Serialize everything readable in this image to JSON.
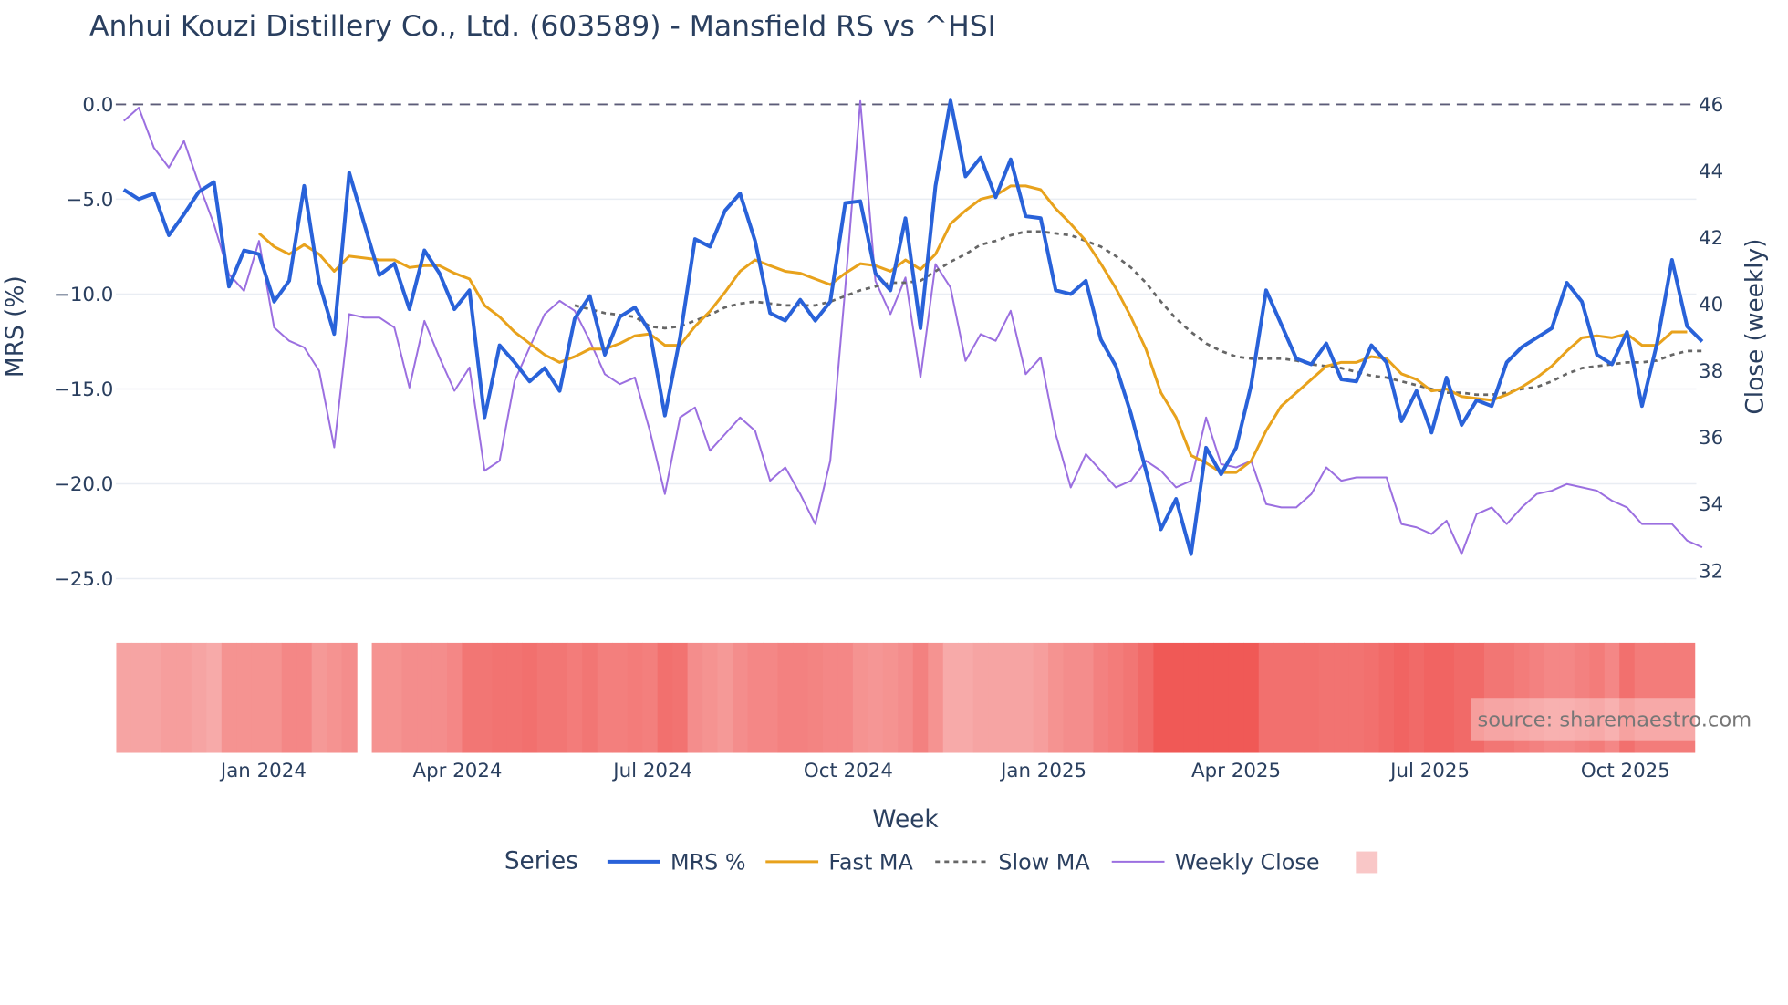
{
  "chart_data": {
    "type": "line",
    "title": "Anhui Kouzi Distillery Co., Ltd. (603589) - Mansfield RS vs ^HSI",
    "xlabel": "Week",
    "ylabel": "MRS (%)",
    "y2label": "Close (weekly)",
    "ylim": [
      -25,
      0
    ],
    "y2lim": [
      32,
      46
    ],
    "y_ticks": [
      "0.0",
      "−5.0",
      "−10.0",
      "−15.0",
      "−20.0",
      "−25.0"
    ],
    "y_tick_values": [
      0,
      -5,
      -10,
      -15,
      -20,
      -25
    ],
    "y2_ticks": [
      "46",
      "44",
      "42",
      "40",
      "38",
      "36",
      "34",
      "32"
    ],
    "y2_tick_values": [
      46,
      44,
      42,
      40,
      38,
      36,
      34,
      32
    ],
    "x_ticks": [
      "Jan 2024",
      "Apr 2024",
      "Jul 2024",
      "Oct 2024",
      "Jan 2025",
      "Apr 2025",
      "Jul 2025",
      "Oct 2025"
    ],
    "x_tick_week_index": [
      9.3,
      22.2,
      35.2,
      48.2,
      61.2,
      74,
      86.9,
      99.9
    ],
    "weeks": 105,
    "grid": true,
    "reference_line": 0,
    "legend_title": "Series",
    "legend_placement": "bottom-center",
    "series": [
      {
        "name": "MRS %",
        "axis": "left",
        "color": "#2962d9",
        "style": "solid",
        "start_index": 0,
        "values": [
          -4.5,
          -5.0,
          -4.7,
          -6.9,
          -5.8,
          -4.6,
          -4.1,
          -9.6,
          -7.7,
          -7.9,
          -10.4,
          -9.3,
          -4.3,
          -9.4,
          -12.1,
          -3.6,
          -6.3,
          -9.0,
          -8.4,
          -10.8,
          -7.7,
          -8.9,
          -10.8,
          -9.8,
          -16.5,
          -12.7,
          -13.6,
          -14.6,
          -13.9,
          -15.1,
          -11.3,
          -10.1,
          -13.2,
          -11.2,
          -10.7,
          -12.0,
          -16.4,
          -12.3,
          -7.1,
          -7.5,
          -5.6,
          -4.7,
          -7.2,
          -11.0,
          -11.4,
          -10.3,
          -11.4,
          -10.4,
          -5.2,
          -5.1,
          -8.9,
          -9.8,
          -6.0,
          -11.8,
          -4.3,
          0.2,
          -3.8,
          -2.8,
          -4.9,
          -2.9,
          -5.9,
          -6.0,
          -9.8,
          -10.0,
          -9.3,
          -12.4,
          -13.8,
          -16.3,
          -19.3,
          -22.4,
          -20.8,
          -23.7,
          -18.1,
          -19.5,
          -18.1,
          -14.8,
          -9.8,
          -11.6,
          -13.4,
          -13.7,
          -12.6,
          -14.5,
          -14.6,
          -12.7,
          -13.6,
          -16.7,
          -15.1,
          -17.3,
          -14.4,
          -16.9,
          -15.6,
          -15.9,
          -13.6,
          -12.8,
          -12.3,
          -11.8,
          -9.4,
          -10.4,
          -13.2,
          -13.7,
          -12.0,
          -15.9,
          -12.6,
          -8.2,
          -11.7,
          -12.5
        ]
      },
      {
        "name": "Fast MA",
        "axis": "left",
        "color": "#e8a21c",
        "style": "solid",
        "start_index": 9,
        "values": [
          -6.8,
          -7.5,
          -7.9,
          -7.4,
          -7.9,
          -8.8,
          -8.0,
          -8.1,
          -8.2,
          -8.2,
          -8.6,
          -8.5,
          -8.5,
          -8.9,
          -9.2,
          -10.6,
          -11.2,
          -12.0,
          -12.6,
          -13.2,
          -13.6,
          -13.3,
          -12.9,
          -12.9,
          -12.6,
          -12.2,
          -12.1,
          -12.7,
          -12.7,
          -11.7,
          -10.9,
          -9.9,
          -8.8,
          -8.2,
          -8.5,
          -8.8,
          -8.9,
          -9.2,
          -9.5,
          -8.9,
          -8.4,
          -8.5,
          -8.8,
          -8.2,
          -8.7,
          -7.9,
          -6.3,
          -5.6,
          -5.0,
          -4.8,
          -4.3,
          -4.3,
          -4.5,
          -5.5,
          -6.3,
          -7.2,
          -8.4,
          -9.7,
          -11.2,
          -12.9,
          -15.2,
          -16.5,
          -18.5,
          -18.9,
          -19.4,
          -19.4,
          -18.8,
          -17.2,
          -15.9,
          -15.2,
          -14.5,
          -13.8,
          -13.6,
          -13.6,
          -13.3,
          -13.4,
          -14.2,
          -14.5,
          -15.1,
          -15.0,
          -15.4,
          -15.5,
          -15.6,
          -15.3,
          -14.9,
          -14.4,
          -13.8,
          -13.0,
          -12.3,
          -12.2,
          -12.3,
          -12.1,
          -12.7,
          -12.7,
          -12.0,
          -12.0
        ]
      },
      {
        "name": "Slow MA",
        "axis": "left",
        "color": "#666666",
        "style": "dotted",
        "start_index": 30,
        "values": [
          -10.6,
          -10.8,
          -11.0,
          -11.1,
          -11.2,
          -11.7,
          -11.8,
          -11.7,
          -11.4,
          -11.1,
          -10.7,
          -10.5,
          -10.4,
          -10.5,
          -10.6,
          -10.6,
          -10.6,
          -10.4,
          -10.1,
          -9.8,
          -9.6,
          -9.4,
          -9.4,
          -9.3,
          -8.8,
          -8.3,
          -7.9,
          -7.4,
          -7.2,
          -6.9,
          -6.7,
          -6.7,
          -6.8,
          -6.9,
          -7.2,
          -7.5,
          -8.0,
          -8.6,
          -9.4,
          -10.4,
          -11.3,
          -12.0,
          -12.6,
          -13.0,
          -13.3,
          -13.4,
          -13.4,
          -13.4,
          -13.5,
          -13.7,
          -13.8,
          -13.9,
          -14.1,
          -14.3,
          -14.4,
          -14.6,
          -14.8,
          -15.0,
          -15.2,
          -15.2,
          -15.3,
          -15.3,
          -15.2,
          -15.0,
          -14.9,
          -14.6,
          -14.2,
          -13.9,
          -13.8,
          -13.7,
          -13.6,
          -13.6,
          -13.5,
          -13.2,
          -13.0,
          -13.0
        ]
      },
      {
        "name": "Weekly Close",
        "axis": "right",
        "color": "#9b6fe0",
        "style": "solid",
        "start_index": 0,
        "values": [
          45.5,
          45.9,
          44.7,
          44.1,
          44.9,
          43.6,
          42.4,
          40.9,
          40.4,
          41.9,
          39.3,
          38.9,
          38.7,
          38.0,
          35.7,
          39.7,
          39.6,
          39.6,
          39.3,
          37.5,
          39.5,
          38.4,
          37.4,
          38.1,
          35.0,
          35.3,
          37.7,
          38.7,
          39.7,
          40.1,
          39.8,
          38.9,
          37.9,
          37.6,
          37.8,
          36.2,
          34.3,
          36.6,
          36.9,
          35.6,
          36.1,
          36.6,
          36.2,
          34.7,
          35.1,
          34.3,
          33.4,
          35.3,
          40.5,
          46.1,
          40.7,
          39.7,
          40.8,
          37.8,
          41.2,
          40.5,
          38.3,
          39.1,
          38.9,
          39.8,
          37.9,
          38.4,
          36.1,
          34.5,
          35.5,
          35.0,
          34.5,
          34.7,
          35.3,
          35.0,
          34.5,
          34.7,
          36.6,
          35.2,
          35.1,
          35.3,
          34.0,
          33.9,
          33.9,
          34.3,
          35.1,
          34.7,
          34.8,
          34.8,
          34.8,
          33.4,
          33.3,
          33.1,
          33.5,
          32.5,
          33.7,
          33.9,
          33.4,
          33.9,
          34.3,
          34.4,
          34.6,
          34.5,
          34.4,
          34.1,
          33.9,
          33.4,
          33.4,
          33.4,
          32.9,
          32.7
        ]
      }
    ],
    "heatmap": {
      "color_low": "#f9c7c7",
      "color_high": "#ef5350",
      "intensity": [
        0.3,
        0.3,
        0.3,
        0.35,
        0.35,
        0.3,
        0.25,
        0.45,
        0.45,
        0.45,
        0.45,
        0.55,
        0.55,
        0.4,
        0.45,
        0.5,
        null,
        0.45,
        0.45,
        0.5,
        0.5,
        0.5,
        0.55,
        0.7,
        0.7,
        0.72,
        0.72,
        0.75,
        0.7,
        0.7,
        0.65,
        0.7,
        0.62,
        0.62,
        0.65,
        0.62,
        0.75,
        0.72,
        0.5,
        0.45,
        0.4,
        0.5,
        0.55,
        0.55,
        0.6,
        0.6,
        0.58,
        0.55,
        0.55,
        0.45,
        0.42,
        0.45,
        0.5,
        0.6,
        0.45,
        0.25,
        0.25,
        0.3,
        0.3,
        0.3,
        0.3,
        0.35,
        0.45,
        0.5,
        0.5,
        0.6,
        0.65,
        0.7,
        0.8,
        0.95,
        0.95,
        0.95,
        0.95,
        0.95,
        0.95,
        0.95,
        0.75,
        0.75,
        0.75,
        0.75,
        0.72,
        0.72,
        0.72,
        0.75,
        0.8,
        0.85,
        0.8,
        0.85,
        0.85,
        0.8,
        0.8,
        0.7,
        0.7,
        0.65,
        0.6,
        0.55,
        0.55,
        0.6,
        0.65,
        0.55,
        0.75,
        0.65,
        0.65,
        0.65,
        0.65
      ]
    },
    "annotation": "source: sharemaestro.com"
  }
}
